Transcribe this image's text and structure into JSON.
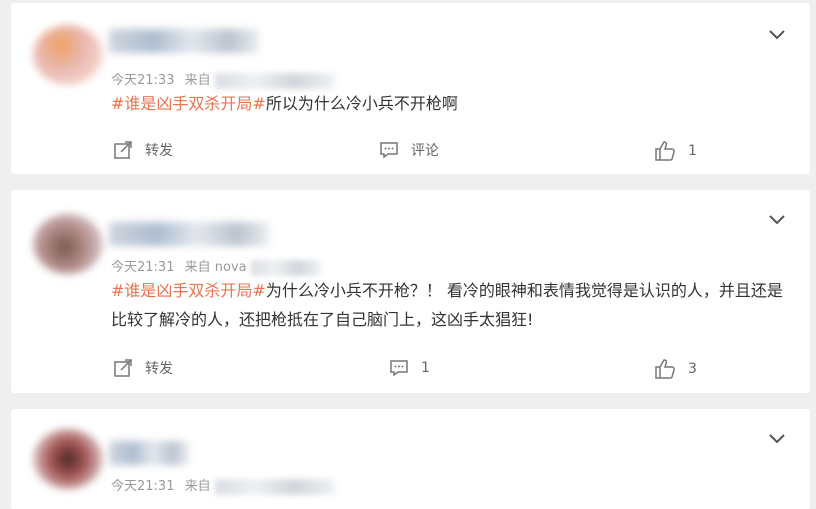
{
  "comments": [
    {
      "time": "今天21:33",
      "source_prefix": "来自",
      "hashtag": "#谁是凶手双杀开局#",
      "text": "所以为什么冷小兵不开枪啊",
      "repost_label": "转发",
      "comment_label": "评论",
      "like_count": "1"
    },
    {
      "time": "今天21:31",
      "source_prefix": "来自",
      "source_visible": "nova",
      "hashtag": "#谁是凶手双杀开局#",
      "text": "为什么冷小兵不开枪？！ 看冷的眼神和表情我觉得是认识的人，并且还是比较了解冷的人，还把枪抵在了自己脑门上，这凶手太猖狂!",
      "repost_label": "转发",
      "comment_count": "1",
      "like_count": "3"
    },
    {
      "time": "今天21:31",
      "source_prefix": "来自"
    }
  ],
  "colors": {
    "hashtag": "#eb7350",
    "text": "#333333",
    "meta": "#9a9a9a",
    "background": "#efefef"
  },
  "icons": [
    "chevron-down-icon",
    "repost-icon",
    "comment-icon",
    "like-icon"
  ]
}
